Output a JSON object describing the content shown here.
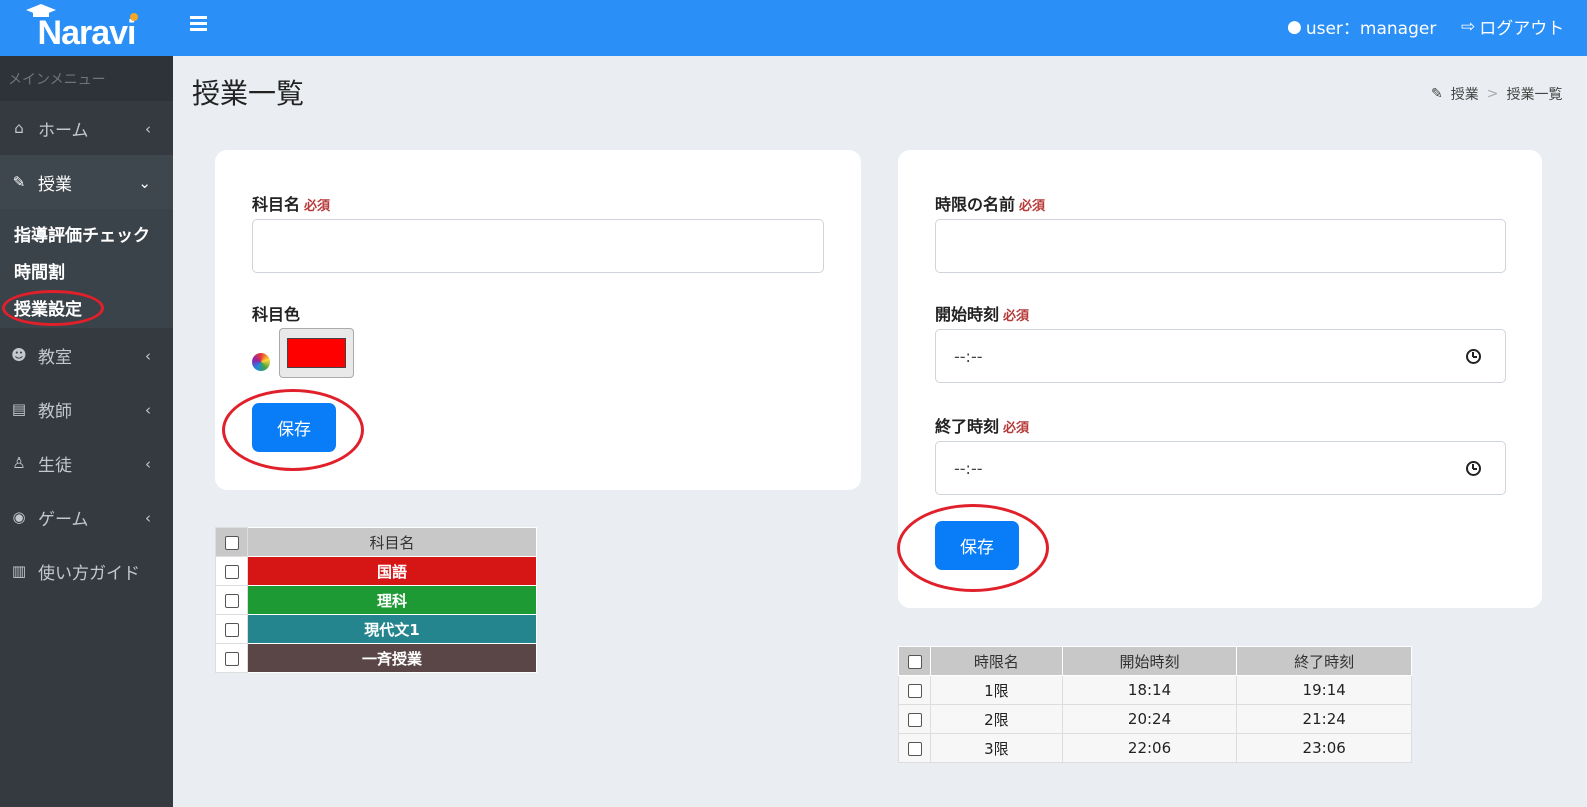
{
  "brand": {
    "name": "Naravi"
  },
  "sidebar": {
    "menu_header": "メインメニュー",
    "items": [
      {
        "label": "ホーム",
        "icon": "home-icon"
      },
      {
        "label": "授業",
        "icon": "edit-icon"
      },
      {
        "label": "教室",
        "icon": "users-icon"
      },
      {
        "label": "教師",
        "icon": "id-card-icon"
      },
      {
        "label": "生徒",
        "icon": "student-icon"
      },
      {
        "label": "ゲーム",
        "icon": "gamepad-icon"
      },
      {
        "label": "使い方ガイド",
        "icon": "book-icon"
      }
    ],
    "subitems": [
      {
        "label": "指導評価チェック"
      },
      {
        "label": "時間割"
      },
      {
        "label": "授業設定"
      }
    ]
  },
  "header": {
    "user": "user：manager",
    "logout": "ログアウト"
  },
  "page": {
    "title": "授業一覧",
    "breadcrumb": [
      "授業",
      ">",
      "授業一覧"
    ]
  },
  "subject_form": {
    "name_label": "科目名",
    "required": "必須",
    "name_value": "",
    "color_label": "科目色",
    "color_value": "#ff0000",
    "save": "保存"
  },
  "period_form": {
    "name_label": "時限の名前",
    "start_label": "開始時刻",
    "end_label": "終了時刻",
    "required": "必須",
    "start_value": "--:--",
    "end_value": "--:--",
    "save": "保存"
  },
  "subject_table": {
    "header": "科目名",
    "rows": [
      {
        "name": "国語",
        "color": "#d61515"
      },
      {
        "name": "理科",
        "color": "#1d9a34"
      },
      {
        "name": "現代文1",
        "color": "#24858e"
      },
      {
        "name": "一斉授業",
        "color": "#5a4646"
      }
    ]
  },
  "period_table": {
    "headers": [
      "時限名",
      "開始時刻",
      "終了時刻"
    ],
    "rows": [
      [
        "1限",
        "18:14",
        "19:14"
      ],
      [
        "2限",
        "20:24",
        "21:24"
      ],
      [
        "3限",
        "22:06",
        "23:06"
      ]
    ]
  }
}
